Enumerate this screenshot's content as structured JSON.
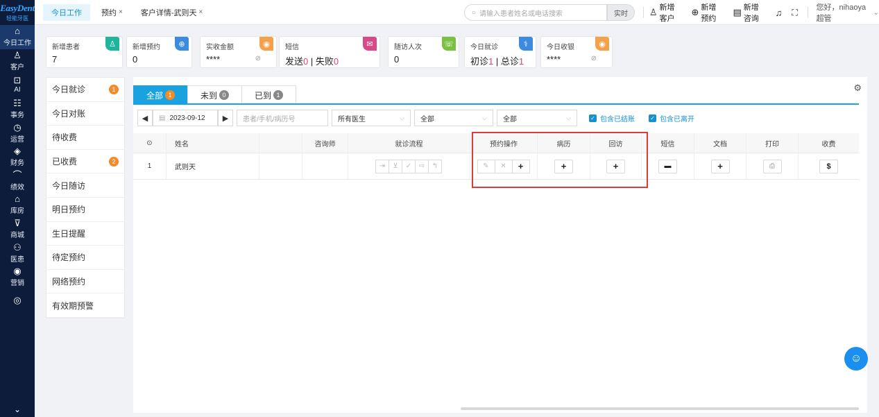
{
  "brand": {
    "name": "EasyDent",
    "sub": "轻能牙医",
    "accent": "#3aa6ff"
  },
  "sidebar": {
    "items": [
      {
        "label": "今日工作",
        "icon": "home-icon",
        "glyph": "⌂"
      },
      {
        "label": "客户",
        "icon": "user-icon",
        "glyph": "♙"
      },
      {
        "label": "AI",
        "icon": "ai-icon",
        "glyph": "⊡"
      },
      {
        "label": "事务",
        "icon": "task-icon",
        "glyph": "☷"
      },
      {
        "label": "运营",
        "icon": "clock-icon",
        "glyph": "◷"
      },
      {
        "label": "财务",
        "icon": "finance-icon",
        "glyph": "◈"
      },
      {
        "label": "绩效",
        "icon": "chart-icon",
        "glyph": "⌒"
      },
      {
        "label": "库房",
        "icon": "warehouse-icon",
        "glyph": "⌂"
      },
      {
        "label": "商城",
        "icon": "cart-icon",
        "glyph": "⊽"
      },
      {
        "label": "医患",
        "icon": "doctor-icon",
        "glyph": "⚇"
      },
      {
        "label": "营销",
        "icon": "marketing-icon",
        "glyph": "◉"
      },
      {
        "label": "",
        "icon": "more-icon",
        "glyph": "◎"
      }
    ],
    "expand_glyph": "⌄"
  },
  "topbar": {
    "tabs": [
      {
        "label": "今日工作",
        "closable": false
      },
      {
        "label": "预约",
        "closable": true
      },
      {
        "label": "客户详情-武则天",
        "closable": true
      }
    ],
    "close_glyph": "×",
    "search_placeholder": "请输入患者姓名或电话搜索",
    "realtime_label": "实时",
    "actions": [
      {
        "label": "新增客户",
        "icon": "add-user-icon",
        "glyph": "♙"
      },
      {
        "label": "新增预约",
        "icon": "add-appointment-icon",
        "glyph": "⊕"
      },
      {
        "label": "新增咨询",
        "icon": "consult-icon",
        "glyph": "▤"
      }
    ],
    "bell_glyph": "♫",
    "fullscreen_glyph": "⛶",
    "greeting": "您好，nihaoya超管"
  },
  "stats": [
    {
      "title": "新增患者",
      "value": "7",
      "badge_color": "#1fb59a"
    },
    {
      "title": "新增预约",
      "value": "0",
      "badge_color": "#3d8be0"
    },
    {
      "title": "实收金额",
      "value": "****",
      "badge_color": "#f5a04a",
      "hidden": true
    },
    {
      "title": "短信",
      "value_parts": [
        "发送",
        "0",
        " | 失败",
        "0"
      ],
      "badge_color": "#d64a8a"
    },
    {
      "title": "随访人次",
      "value": "0",
      "badge_color": "#7ac043"
    },
    {
      "title": "今日就诊",
      "value_parts": [
        "初诊",
        "1",
        " | 总诊",
        "1"
      ],
      "badge_color": "#3d8be0"
    },
    {
      "title": "今日收银",
      "value": "****",
      "badge_color": "#f5a04a",
      "hidden": true
    }
  ],
  "subnav": [
    {
      "label": "今日就诊",
      "badge": "1"
    },
    {
      "label": "今日对账"
    },
    {
      "label": "待收费"
    },
    {
      "label": "已收费",
      "badge": "2"
    },
    {
      "label": "今日随访"
    },
    {
      "label": "明日预约"
    },
    {
      "label": "生日提醒"
    },
    {
      "label": "待定预约"
    },
    {
      "label": "网络预约"
    },
    {
      "label": "有效期预警"
    }
  ],
  "filter_tabs": [
    {
      "label": "全部",
      "count": "1"
    },
    {
      "label": "未到",
      "count": "0"
    },
    {
      "label": "已到",
      "count": "1"
    }
  ],
  "filters": {
    "date": "2023-09-12",
    "patient_placeholder": "患者/手机/病历号",
    "doctor": "所有医生",
    "status1": "全部",
    "status2": "全部",
    "checkbox1": "包含已结账",
    "checkbox2": "包含已离开"
  },
  "table": {
    "columns": [
      "姓名",
      "咨询师",
      "就诊流程",
      "预约操作",
      "病历",
      "回访",
      "短信",
      "文档",
      "打印",
      "收费"
    ],
    "rows": [
      {
        "index": "1",
        "name": "武则天",
        "counselor": ""
      }
    ]
  },
  "highlight_color": "#e03b3b"
}
